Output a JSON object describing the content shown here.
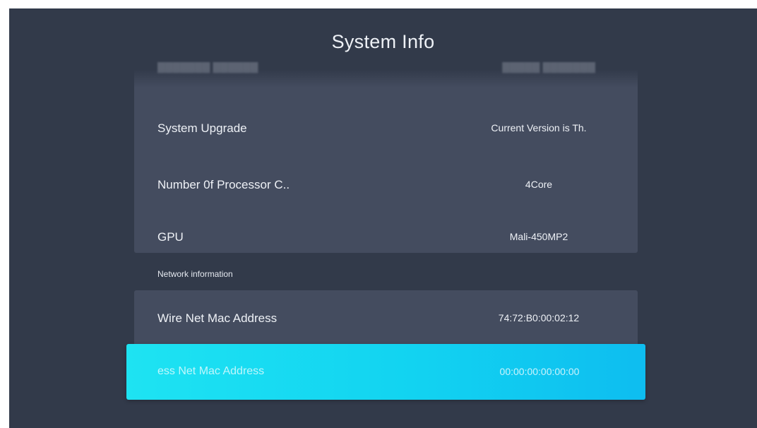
{
  "title": "System Info",
  "system_rows": [
    {
      "label": "System Upgrade",
      "value": "Current Version is Th."
    },
    {
      "label": "Number 0f Processor C..",
      "value": "4Core"
    },
    {
      "label": "GPU",
      "value": "Mali-450MP2"
    }
  ],
  "network_section": {
    "label": "Network information",
    "rows": [
      {
        "label": "Wire Net Mac Address",
        "value": "74:72:B0:00:02:12"
      }
    ],
    "selected_row": {
      "label": "ess Net Mac Address",
      "value": "00:00:00:00:00:00"
    }
  },
  "colors": {
    "background": "#323a4a",
    "card": "#444c5f",
    "selection_start": "#1ee3f2",
    "selection_end": "#0ebdf0",
    "text": "#eef1f6"
  }
}
